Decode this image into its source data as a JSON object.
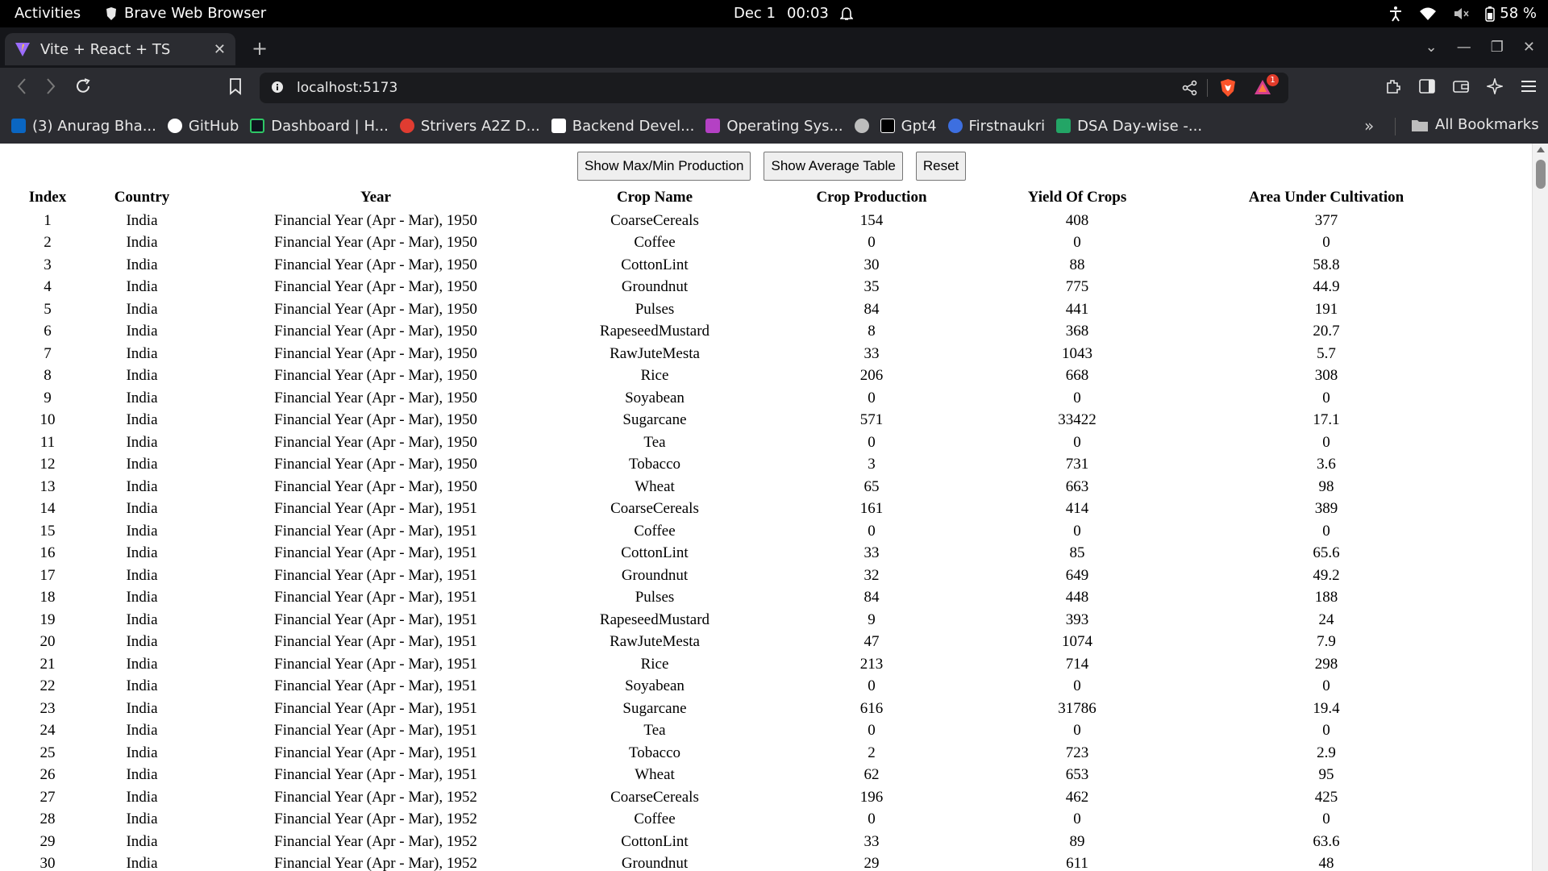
{
  "system": {
    "activities": "Activities",
    "app_name": "Brave Web Browser",
    "date": "Dec 1",
    "time": "00:03",
    "battery": "58 %"
  },
  "browser": {
    "tab_title": "Vite + React + TS",
    "url": "localhost:5173",
    "notification_count": "1",
    "bookmarks": [
      {
        "label": "(3) Anurag Bha...",
        "icon": "linkedin-icon",
        "color": "#0a66c2"
      },
      {
        "label": "GitHub",
        "icon": "github-icon",
        "color": "#ffffff"
      },
      {
        "label": "Dashboard | H...",
        "icon": "hackerrank-icon",
        "color": "#2ec866"
      },
      {
        "label": "Strivers A2Z D...",
        "icon": "tuf-icon",
        "color": "#e03c31"
      },
      {
        "label": "Backend Devel...",
        "icon": "roadmap-icon",
        "color": "#ffffff"
      },
      {
        "label": "Operating Sys...",
        "icon": "os-icon",
        "color": "#b441c4"
      },
      {
        "label": "",
        "icon": "globe-icon",
        "color": "#bdbdbd"
      },
      {
        "label": "Gpt4",
        "icon": "gpt-icon",
        "color": "#000000"
      },
      {
        "label": "Firstnaukri",
        "icon": "firstnaukri-icon",
        "color": "#3d6fe0"
      },
      {
        "label": "DSA Day-wise -...",
        "icon": "sheets-icon",
        "color": "#23a566"
      }
    ],
    "all_bookmarks": "All Bookmarks"
  },
  "page": {
    "buttons": {
      "maxmin": "Show Max/Min Production",
      "average": "Show Average Table",
      "reset": "Reset"
    },
    "table": {
      "headers": [
        "Index",
        "Country",
        "Year",
        "Crop Name",
        "Crop Production",
        "Yield Of Crops",
        "Area Under Cultivation"
      ],
      "rows": [
        [
          "1",
          "India",
          "Financial Year (Apr - Mar), 1950",
          "CoarseCereals",
          "154",
          "408",
          "377"
        ],
        [
          "2",
          "India",
          "Financial Year (Apr - Mar), 1950",
          "Coffee",
          "0",
          "0",
          "0"
        ],
        [
          "3",
          "India",
          "Financial Year (Apr - Mar), 1950",
          "CottonLint",
          "30",
          "88",
          "58.8"
        ],
        [
          "4",
          "India",
          "Financial Year (Apr - Mar), 1950",
          "Groundnut",
          "35",
          "775",
          "44.9"
        ],
        [
          "5",
          "India",
          "Financial Year (Apr - Mar), 1950",
          "Pulses",
          "84",
          "441",
          "191"
        ],
        [
          "6",
          "India",
          "Financial Year (Apr - Mar), 1950",
          "RapeseedMustard",
          "8",
          "368",
          "20.7"
        ],
        [
          "7",
          "India",
          "Financial Year (Apr - Mar), 1950",
          "RawJuteMesta",
          "33",
          "1043",
          "5.7"
        ],
        [
          "8",
          "India",
          "Financial Year (Apr - Mar), 1950",
          "Rice",
          "206",
          "668",
          "308"
        ],
        [
          "9",
          "India",
          "Financial Year (Apr - Mar), 1950",
          "Soyabean",
          "0",
          "0",
          "0"
        ],
        [
          "10",
          "India",
          "Financial Year (Apr - Mar), 1950",
          "Sugarcane",
          "571",
          "33422",
          "17.1"
        ],
        [
          "11",
          "India",
          "Financial Year (Apr - Mar), 1950",
          "Tea",
          "0",
          "0",
          "0"
        ],
        [
          "12",
          "India",
          "Financial Year (Apr - Mar), 1950",
          "Tobacco",
          "3",
          "731",
          "3.6"
        ],
        [
          "13",
          "India",
          "Financial Year (Apr - Mar), 1950",
          "Wheat",
          "65",
          "663",
          "98"
        ],
        [
          "14",
          "India",
          "Financial Year (Apr - Mar), 1951",
          "CoarseCereals",
          "161",
          "414",
          "389"
        ],
        [
          "15",
          "India",
          "Financial Year (Apr - Mar), 1951",
          "Coffee",
          "0",
          "0",
          "0"
        ],
        [
          "16",
          "India",
          "Financial Year (Apr - Mar), 1951",
          "CottonLint",
          "33",
          "85",
          "65.6"
        ],
        [
          "17",
          "India",
          "Financial Year (Apr - Mar), 1951",
          "Groundnut",
          "32",
          "649",
          "49.2"
        ],
        [
          "18",
          "India",
          "Financial Year (Apr - Mar), 1951",
          "Pulses",
          "84",
          "448",
          "188"
        ],
        [
          "19",
          "India",
          "Financial Year (Apr - Mar), 1951",
          "RapeseedMustard",
          "9",
          "393",
          "24"
        ],
        [
          "20",
          "India",
          "Financial Year (Apr - Mar), 1951",
          "RawJuteMesta",
          "47",
          "1074",
          "7.9"
        ],
        [
          "21",
          "India",
          "Financial Year (Apr - Mar), 1951",
          "Rice",
          "213",
          "714",
          "298"
        ],
        [
          "22",
          "India",
          "Financial Year (Apr - Mar), 1951",
          "Soyabean",
          "0",
          "0",
          "0"
        ],
        [
          "23",
          "India",
          "Financial Year (Apr - Mar), 1951",
          "Sugarcane",
          "616",
          "31786",
          "19.4"
        ],
        [
          "24",
          "India",
          "Financial Year (Apr - Mar), 1951",
          "Tea",
          "0",
          "0",
          "0"
        ],
        [
          "25",
          "India",
          "Financial Year (Apr - Mar), 1951",
          "Tobacco",
          "2",
          "723",
          "2.9"
        ],
        [
          "26",
          "India",
          "Financial Year (Apr - Mar), 1951",
          "Wheat",
          "62",
          "653",
          "95"
        ],
        [
          "27",
          "India",
          "Financial Year (Apr - Mar), 1952",
          "CoarseCereals",
          "196",
          "462",
          "425"
        ],
        [
          "28",
          "India",
          "Financial Year (Apr - Mar), 1952",
          "Coffee",
          "0",
          "0",
          "0"
        ],
        [
          "29",
          "India",
          "Financial Year (Apr - Mar), 1952",
          "CottonLint",
          "33",
          "89",
          "63.6"
        ],
        [
          "30",
          "India",
          "Financial Year (Apr - Mar), 1952",
          "Groundnut",
          "29",
          "611",
          "48"
        ]
      ]
    }
  }
}
